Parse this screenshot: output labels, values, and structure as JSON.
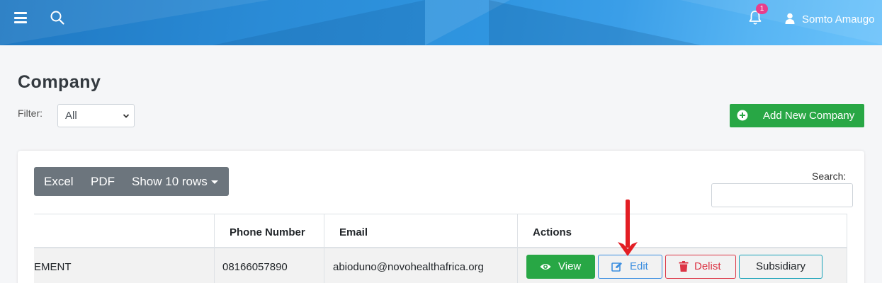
{
  "header": {
    "notification_count": "1",
    "user_name": "Somto Amaugo",
    "icons": [
      "menu-icon",
      "search-icon",
      "bell-icon",
      "user-icon"
    ]
  },
  "page": {
    "title": "Company",
    "filter_label": "Filter:",
    "filter_value": "All",
    "add_button": "Add New Company"
  },
  "toolbar": {
    "excel": "Excel",
    "pdf": "PDF",
    "show_rows": "Show 10 rows",
    "search_label": "Search:"
  },
  "table": {
    "headers": [
      "",
      "Phone Number",
      "Email",
      "Actions"
    ],
    "rows": [
      {
        "name": "EMENT",
        "phone": "08166057890",
        "email": "abioduno@novohealthafrica.org",
        "actions": [
          "View",
          "Edit",
          "Delist",
          "Subsidiary"
        ]
      }
    ]
  },
  "colors": {
    "primary": "#2a8bd6",
    "success": "#28a745",
    "danger": "#dc3545",
    "info": "#17a2b8",
    "badge": "#e83e8c",
    "annotation_arrow": "#e31e24"
  }
}
